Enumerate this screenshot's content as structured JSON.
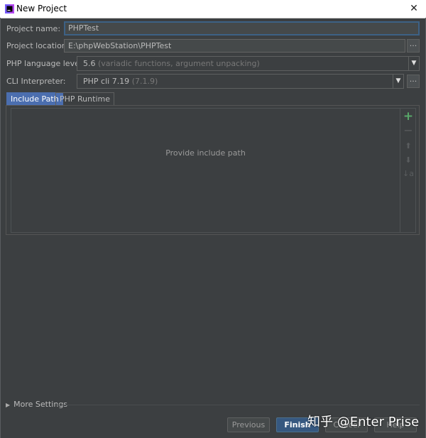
{
  "window": {
    "title": "New Project",
    "close_icon": "close-icon",
    "app_icon": "phpstorm-app-icon"
  },
  "form": {
    "project_name_label": "Project name:",
    "project_name_value": "PHPTest",
    "project_location_label": "Project location:",
    "project_location_value": "E:\\phpWebStation\\PHPTest",
    "browse_label": "...",
    "php_level_label": "PHP language level:",
    "php_level_value": "5.6",
    "php_level_detail": "(variadic functions, argument unpacking)",
    "cli_label": "CLI Interpreter:",
    "cli_value": "PHP cli 7.19",
    "cli_detail": "(7.1.9)"
  },
  "tabs": [
    {
      "label": "Include Path",
      "selected": true
    },
    {
      "label": "PHP Runtime",
      "selected": false
    }
  ],
  "include_path": {
    "empty_text": "Provide include path",
    "toolbar": [
      "add-icon",
      "remove-icon",
      "move-up-icon",
      "move-down-icon",
      "sort-icon"
    ]
  },
  "footer": {
    "more_settings": "More Settings",
    "buttons": {
      "previous": "Previous",
      "finish": "Finish",
      "cancel": "Cancel",
      "help": "Help"
    }
  },
  "watermark": "知乎 @Enter Prise",
  "colors": {
    "background": "#3c3f41",
    "selected_tab": "#4b6eaf",
    "primary_button": "#365880",
    "add_icon": "#59a869"
  }
}
